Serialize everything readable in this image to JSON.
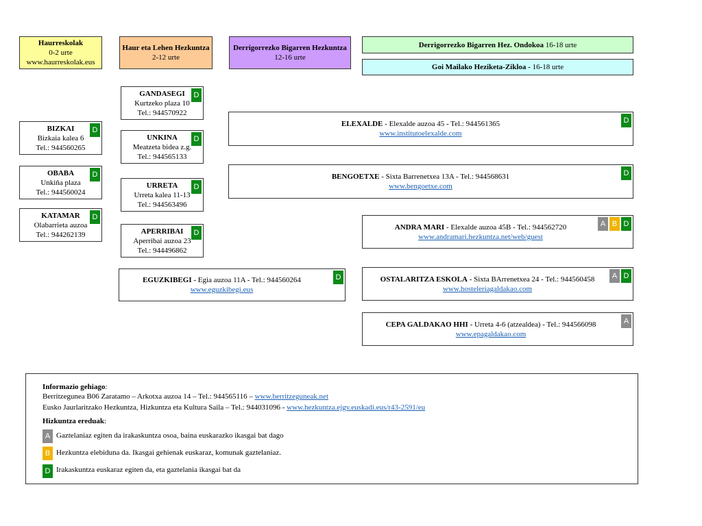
{
  "headers": {
    "haurreskolak": {
      "title": "Haurreskolak",
      "age": "0-2 urte",
      "web": "www.haurreskolak.eus"
    },
    "lehen": {
      "title": "Haur eta Lehen Hezkuntza",
      "age": "2-12 urte"
    },
    "dbh": {
      "title": "Derrigorrezko Bigarren Hezkuntza",
      "age": "12-16 urte"
    },
    "ondokoa": {
      "title": "Derrigorrezko Bigarren Hez. Ondokoa",
      "age": "16-18 urte"
    },
    "goimailako": {
      "title": "Goi Mailako Heziketa-Zikloa -",
      "age": "16-18 urte"
    }
  },
  "haurreskolak_list": [
    {
      "name": "BIZKAI",
      "address": "Bizkaia kalea 6",
      "tel": "Tel.: 944560265",
      "model": "D"
    },
    {
      "name": "OBABA",
      "address": "Unkiña plaza",
      "tel": "Tel.: 944560024",
      "model": "D"
    },
    {
      "name": "KATAMAR",
      "address": "Olabarrieta auzoa",
      "tel": "Tel.: 944262139",
      "model": "D"
    }
  ],
  "lehen_list": [
    {
      "name": "GANDASEGI",
      "address": "Kurtzeko plaza 10",
      "tel": "Tel.: 944570922",
      "model": "D"
    },
    {
      "name": "UNKINA",
      "address": "Meatzeta bidea z.g.",
      "tel": "Tel.: 944565133",
      "model": "D"
    },
    {
      "name": "URRETA",
      "address": "Urreta kalea 11-13",
      "tel": "Tel.: 944563496",
      "model": "D"
    },
    {
      "name": "APERRIBAI",
      "address": "Aperribai auzoa 23",
      "tel": "Tel.: 944496862",
      "model": "D"
    }
  ],
  "eguzkibegi": {
    "name": "EGUZKIBEGI",
    "details": " - Egia auzoa 11A - Tel.: 944560264",
    "web": "www.eguzkibegi.eus",
    "model": "D"
  },
  "elexalde": {
    "name": "ELEXALDE",
    "details": " - Elexalde auzoa 45 - Tel.: 944561365",
    "web": "www.institutoelexalde.com",
    "model": "D"
  },
  "bengoetxe": {
    "name": "BENGOETXE",
    "details": " - Sixta Barrenetxea 13A - Tel.: 944568631",
    "web": "www.bengoetxe.com",
    "model": "D"
  },
  "andramari": {
    "name": "ANDRA MARI",
    "details": " - Elexalde auzoa 45B - Tel.: 944562720",
    "web": "www.andramari.hezkuntza.net/web/guest",
    "models": [
      "A",
      "B",
      "D"
    ]
  },
  "ostalaritza": {
    "name": "OSTALARITZA ESKOLA",
    "details": " - Sixta BArrenetxea 24 - Tel.: 944560458",
    "web": "www.hosteleriagaldakao.com",
    "models": [
      "A",
      "D"
    ]
  },
  "cepa": {
    "name": "CEPA GALDAKAO HHI",
    "details": " - Urreta 4-6 (atzealdea) - Tel.: 944566098",
    "web": "www.epagaldakao.com",
    "models": [
      "A"
    ]
  },
  "info": {
    "title": "Informazio gehiago",
    "line1_text": "Berritzegunea B06 Zaratamo – Arkotxa auzoa 14 – Tel.: 944565116 – ",
    "line1_link": "www.berritzeguneak.net",
    "line2_text": "Eusko Jaurlaritzako Hezkuntza, Hizkuntza eta Kultura Saila – Tel.: 944031096 - ",
    "line2_link": "www.hezkuntza.ejgv.euskadi.eus/r43-2591/eu",
    "legend_title": "Hizkuntza ereduak",
    "legend": [
      {
        "code": "A",
        "text": "Gaztelaniaz egiten da irakaskuntza osoa, baina euskarazko ikasgai bat dago"
      },
      {
        "code": "B",
        "text": "Hezkuntza elebiduna da. Ikasgai gehienak euskaraz, komunak gaztelaniaz."
      },
      {
        "code": "D",
        "text": "Irakaskuntza euskaraz egiten da, eta gaztelania ikasgai bat da"
      }
    ]
  },
  "colors": {
    "haurreskolak": "#fdfd99",
    "lehen": "#fdca96",
    "dbh": "#cc9bfc",
    "ondokoa": "#ccfdcc",
    "goimailako": "#ccfdfd",
    "model_A": "#8c8c8c",
    "model_B": "#f0b400",
    "model_D": "#0c8a18"
  }
}
